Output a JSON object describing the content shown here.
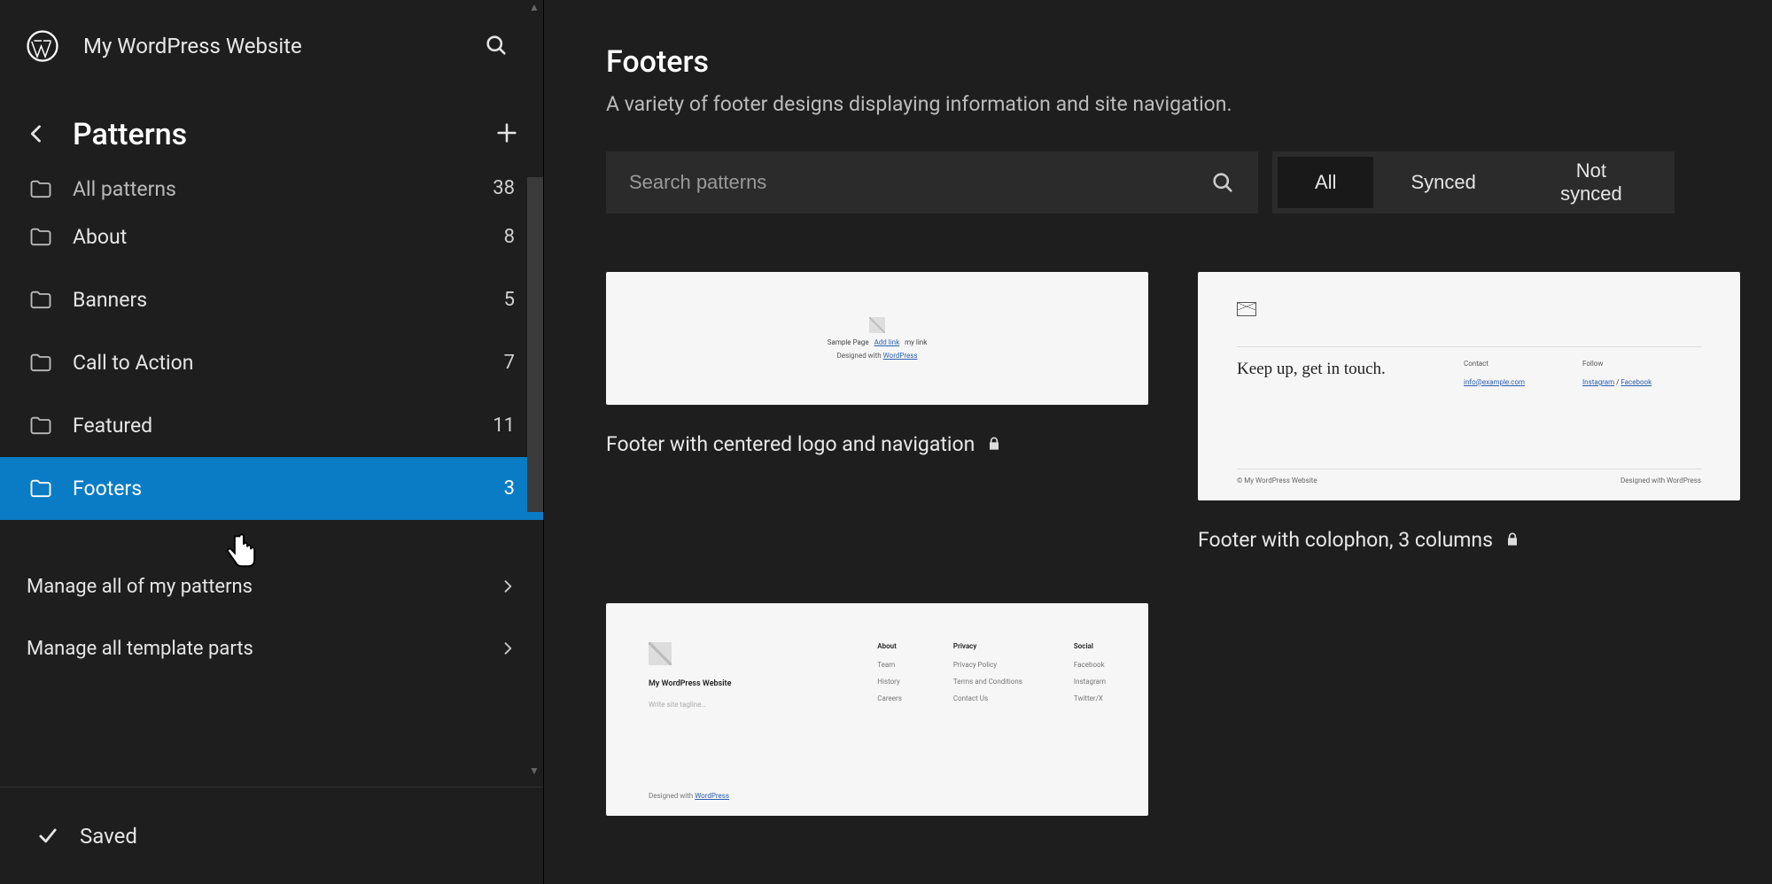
{
  "header": {
    "site_title": "My WordPress Website"
  },
  "sidebar": {
    "section_title": "Patterns",
    "scroll_triangles": {
      "top": "▲",
      "bottom": "▼"
    },
    "categories": [
      {
        "label": "All patterns",
        "count": "38",
        "partial": true
      },
      {
        "label": "About",
        "count": "8"
      },
      {
        "label": "Banners",
        "count": "5"
      },
      {
        "label": "Call to Action",
        "count": "7"
      },
      {
        "label": "Featured",
        "count": "11"
      },
      {
        "label": "Footers",
        "count": "3",
        "active": true
      }
    ],
    "manage": [
      {
        "label": "Manage all of my patterns"
      },
      {
        "label": "Manage all template parts"
      }
    ],
    "saved_label": "Saved"
  },
  "main": {
    "title": "Footers",
    "description": "A variety of footer designs displaying information and site navigation.",
    "search_placeholder": "Search patterns",
    "filters": {
      "all": "All",
      "synced": "Synced",
      "not_synced": "Not synced",
      "active": "all"
    },
    "patterns": [
      {
        "title": "Footer with centered logo and navigation",
        "locked": true,
        "preview": {
          "kind": "pv1",
          "links": {
            "l1": "Sample Page",
            "l2": "Add link",
            "l3": "my link"
          },
          "credit_prefix": "Designed with ",
          "credit_link": "WordPress"
        }
      },
      {
        "title": "Footer with colophon, 3 columns",
        "locked": true,
        "preview": {
          "kind": "pv2",
          "keep": "Keep up, get in touch.",
          "col1": {
            "h": "Contact",
            "lnk": "info@example.com"
          },
          "col2": {
            "h": "Follow",
            "l1": "Instagram",
            "sep": " / ",
            "l2": "Facebook"
          },
          "bl": "© My WordPress Website",
          "br_prefix": "Designed with ",
          "br_link": "WordPress"
        }
      },
      {
        "title": "",
        "locked": false,
        "preview": {
          "kind": "pv3",
          "site": "My WordPress Website",
          "tag": "Write site tagline…",
          "cols": [
            {
              "h": "About",
              "items": [
                "Team",
                "History",
                "Careers"
              ]
            },
            {
              "h": "Privacy",
              "items": [
                "Privacy Policy",
                "Terms and Conditions",
                "Contact Us"
              ]
            },
            {
              "h": "Social",
              "items": [
                "Facebook",
                "Instagram",
                "Twitter/X"
              ]
            }
          ],
          "credit_prefix": "Designed with ",
          "credit_link": "WordPress"
        }
      }
    ]
  }
}
